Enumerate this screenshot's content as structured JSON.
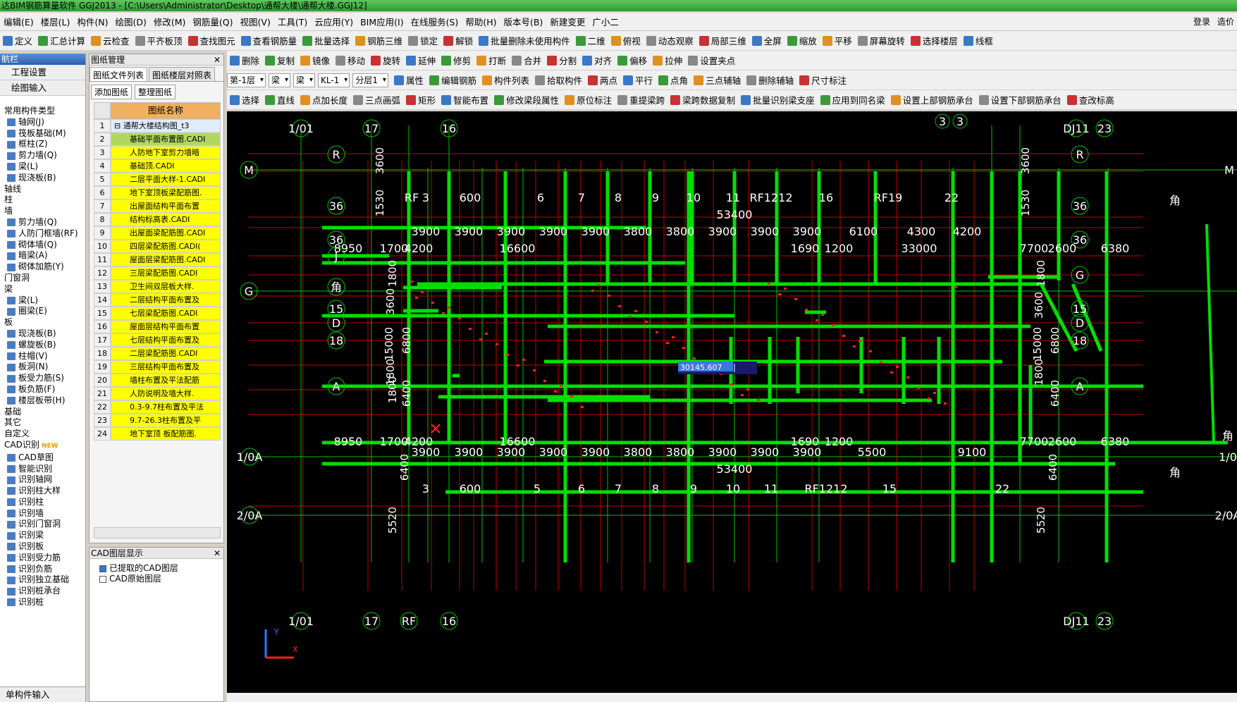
{
  "title": "达BIM钢筋算量软件 GGJ2013 - [C:\\Users\\Administrator\\Desktop\\通帮大楼\\通帮大楼.GGJ12]",
  "menu": [
    "编辑(E)",
    "楼层(L)",
    "构件(N)",
    "绘图(D)",
    "修改(M)",
    "钢筋量(Q)",
    "视图(V)",
    "工具(T)",
    "云应用(Y)",
    "BIM应用(I)",
    "在线服务(S)",
    "帮助(H)",
    "版本号(B)",
    "新建变更",
    "广小二"
  ],
  "menu_right": [
    "登录",
    "造价"
  ],
  "toolbar1": [
    "定义",
    "汇总计算",
    "云检查",
    "平齐板顶",
    "查找图元",
    "查看钢筋量",
    "批量选择",
    "钢筋三维",
    "锁定",
    "解锁",
    "批量删除未使用构件",
    "二维",
    "俯视",
    "动态观察",
    "局部三维",
    "全屏",
    "缩放",
    "平移",
    "屏幕旋转",
    "选择楼层",
    "线框"
  ],
  "toolbar2": [
    "删除",
    "复制",
    "镜像",
    "移动",
    "旋转",
    "延伸",
    "修剪",
    "打断",
    "合并",
    "分割",
    "对齐",
    "偏移",
    "拉伸",
    "设置夹点"
  ],
  "toolbar3": {
    "floor": "第-1层",
    "type": "梁",
    "subtype": "梁",
    "member": "KL-1",
    "layer": "分层1",
    "buttons": [
      "属性",
      "编辑钢筋",
      "构件列表",
      "拾取构件",
      "两点",
      "平行",
      "点角",
      "三点辅轴",
      "删除辅轴",
      "尺寸标注"
    ]
  },
  "toolbar4": [
    "选择",
    "直线",
    "点加长度",
    "三点画弧",
    "矩形",
    "智能布置",
    "修改梁段属性",
    "原位标注",
    "重提梁跨",
    "梁跨数据复制",
    "批量识别梁支座",
    "应用到同名梁",
    "设置上部钢筋承台",
    "设置下部钢筋承台",
    "查改标高"
  ],
  "sidebar": {
    "head": "航栏",
    "buttons": [
      "工程设置",
      "绘图输入"
    ],
    "tree": [
      {
        "g": "常用构件类型"
      },
      {
        "i": "轴网(J)"
      },
      {
        "i": "筏板基础(M)"
      },
      {
        "i": "框柱(Z)"
      },
      {
        "i": "剪力墙(Q)"
      },
      {
        "i": "梁(L)"
      },
      {
        "i": "现浇板(B)"
      },
      {
        "g": "轴线"
      },
      {
        "g": "柱"
      },
      {
        "g": "墙"
      },
      {
        "i": "剪力墙(Q)"
      },
      {
        "i": "人防门框墙(RF)"
      },
      {
        "i": "砌体墙(Q)"
      },
      {
        "i": "暗梁(A)"
      },
      {
        "i": "砌体加筋(Y)"
      },
      {
        "g": "门窗洞"
      },
      {
        "g": "梁"
      },
      {
        "i": "梁(L)"
      },
      {
        "i": "圈梁(E)"
      },
      {
        "g": "板"
      },
      {
        "i": "现浇板(B)"
      },
      {
        "i": "螺旋板(B)"
      },
      {
        "i": "柱帽(V)"
      },
      {
        "i": "板洞(N)"
      },
      {
        "i": "板受力筋(S)"
      },
      {
        "i": "板负筋(F)"
      },
      {
        "i": "楼层板带(H)"
      },
      {
        "g": "基础"
      },
      {
        "g": "其它"
      },
      {
        "g": "自定义"
      },
      {
        "g": "CAD识别"
      },
      {
        "i": "CAD草图"
      },
      {
        "i": "智能识别"
      },
      {
        "i": "识别轴网"
      },
      {
        "i": "识别柱大样"
      },
      {
        "i": "识别柱"
      },
      {
        "i": "识别墙"
      },
      {
        "i": "识别门窗洞"
      },
      {
        "i": "识别梁"
      },
      {
        "i": "识别板"
      },
      {
        "i": "识别受力筋"
      },
      {
        "i": "识别负筋"
      },
      {
        "i": "识别独立基础"
      },
      {
        "i": "识别桩承台"
      },
      {
        "i": "识别桩"
      }
    ],
    "new_badge": "NEW",
    "footer": "单构件输入"
  },
  "drawing_panel": {
    "title": "图纸管理",
    "tabs": [
      "图纸文件列表",
      "图纸楼层对照表"
    ],
    "buttons": [
      "添加图纸",
      "整理图纸"
    ],
    "col_header": "图纸名称",
    "rows": [
      "通帮大楼结构图_t3",
      "基础平面布置图.CADI",
      "人防地下室剪力墙暗",
      "基础顶.CADI",
      "二层平面大样-1.CADI",
      "地下室顶板梁配筋图.",
      "出屋面结构平面布置",
      "结构标高表.CADI",
      "出屋面梁配筋图.CADI",
      "四层梁配筋图.CADI(",
      "屋面层梁配筋图.CADI",
      "三层梁配筋图.CADI",
      "卫生间双层板大样.",
      "二层结构平面布置及",
      "七层梁配筋图.CADI",
      "屋面层结构平面布置",
      "七层结构平面布置及",
      "二层梁配筋图.CADI",
      "三层结构平面布置及",
      "墙柱布置及平法配筋",
      "人防说明及墙大样.",
      "0.3-9.7柱布置及平法",
      "9.7-26.3柱布置及平",
      "地下室顶 板配筋图."
    ]
  },
  "cad_layer_panel": {
    "title": "CAD图层显示",
    "layers": [
      "已提取的CAD图层",
      "CAD原始图层"
    ]
  },
  "canvas": {
    "axis_top": [
      "1/01",
      "17",
      "16",
      "3",
      "3",
      "DJ11",
      "23"
    ],
    "axis_top_row2": [
      "RF",
      "3",
      "600",
      "6",
      "7",
      "8",
      "9",
      "10",
      "11",
      "RF1212",
      "16",
      "RF19",
      "22"
    ],
    "axis_bottom": [
      "1/01",
      "17",
      "RF",
      "16",
      "DJ11",
      "23"
    ],
    "axis_bottom_row2": [
      "3",
      "600",
      "5",
      "6",
      "7",
      "8",
      "9",
      "10",
      "11",
      "RF1212",
      "15",
      "22"
    ],
    "axis_left": [
      "M",
      "G",
      "1/0A",
      "2/0A"
    ],
    "axis_right": [
      "M",
      "角",
      "1/0",
      "2/0A"
    ],
    "row_labels_left": [
      "R",
      "36",
      "36",
      "J",
      "角",
      "15",
      "D",
      "18",
      "A"
    ],
    "row_labels_right": [
      "R",
      "36",
      "36",
      "G",
      "15",
      "D",
      "18",
      "A",
      "角",
      "角"
    ],
    "dim_top_total": "53400",
    "dim_top_spans": [
      "3900",
      "3900",
      "3900",
      "3900",
      "3900",
      "3800",
      "3800",
      "3900",
      "3900",
      "3900",
      "6100",
      "4300",
      "4200"
    ],
    "dim_top_row2": [
      "8950",
      "1700",
      "4200",
      "16600",
      "1690",
      "1200",
      "33000",
      "7700",
      "2600",
      "6380"
    ],
    "dim_bottom_row1": [
      "8950",
      "1700",
      "4200",
      "16600",
      "1690",
      "1200",
      "7700",
      "2600",
      "6380"
    ],
    "dim_bottom_spans": [
      "3900",
      "3900",
      "3900",
      "3900",
      "3900",
      "3800",
      "3800",
      "3900",
      "3900",
      "3900",
      "5500",
      "9100"
    ],
    "dim_bottom_total": "53400",
    "dim_vertical_left": [
      "3600",
      "1530",
      "1800",
      "3600",
      "6800",
      "1800",
      "1800",
      "15000",
      "6400",
      "6400",
      "5520"
    ],
    "dim_vertical_right": [
      "3600",
      "1530",
      "1800",
      "3600",
      "6800",
      "1800",
      "15000",
      "6400",
      "6400",
      "5520"
    ],
    "input_value": "30145.607",
    "ucs_y": "Y",
    "ucs_x": "X"
  },
  "colors": {
    "beam": "#00e000",
    "axis": "#00c000",
    "grid_red": "#c00000",
    "text": "#ffffff",
    "bg": "#000000"
  }
}
